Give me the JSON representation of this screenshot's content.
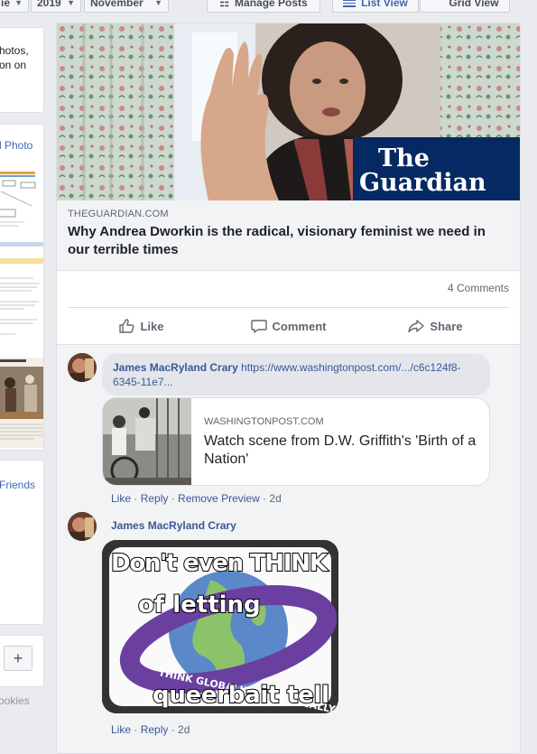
{
  "filters": {
    "partial_label": "ie",
    "year": "2019",
    "month": "November",
    "manage_posts": "Manage Posts",
    "list_view": "List View",
    "grid_view": "Grid View"
  },
  "left_column": {
    "card1_text": [
      "hotos,",
      "on on"
    ],
    "card2_label": "l Photo",
    "friends_label": "Friends",
    "plus_label": "+",
    "cookies_label": "ookies"
  },
  "post": {
    "brand_logo": "The Guardian",
    "domain": "THEGUARDIAN.COM",
    "headline": "Why Andrea Dworkin is the radical, visionary feminist we need in our terrible times",
    "comment_count": "4 Comments",
    "actions": {
      "like": "Like",
      "comment": "Comment",
      "share": "Share"
    }
  },
  "comments": [
    {
      "author": "James MacRyland Crary",
      "link_text": "https://www.washingtonpost.com/.../c6c124f8-6345-11e7...",
      "preview": {
        "domain": "WASHINGTONPOST.COM",
        "title": "Watch scene from D.W. Griffith's 'Birth of a Nation'"
      },
      "like": "Like",
      "reply": "Reply",
      "remove_preview": "Remove Preview",
      "time": "2d"
    },
    {
      "author": "James MacRyland Crary",
      "meme": {
        "line1": "Don't even THINK",
        "line2": "of letting",
        "line3": "queerbait tell",
        "ring_text": "THINK GLOBALLY • ACT LOCALLY"
      },
      "like": "Like",
      "reply": "Reply",
      "time": "2d"
    }
  ],
  "colors": {
    "link_blue": "#385898",
    "guardian_blue": "#052962",
    "page_bg": "#e9ebee"
  }
}
